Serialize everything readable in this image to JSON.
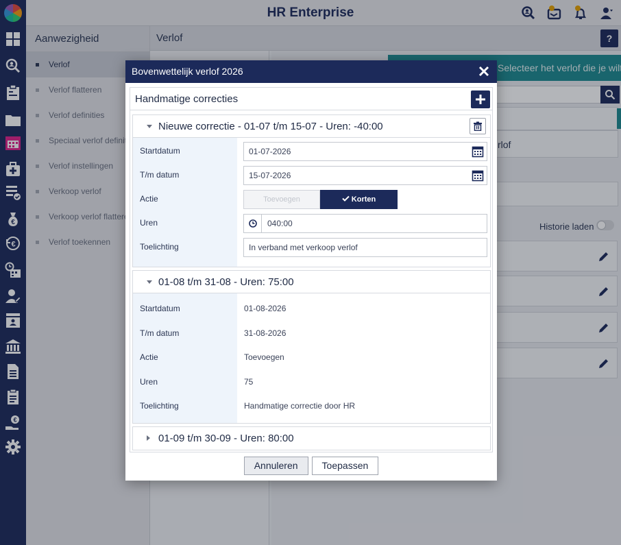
{
  "app": {
    "title": "HR Enterprise"
  },
  "sidebar": {
    "header": "Aanwezigheid",
    "items": [
      {
        "label": "Verlof"
      },
      {
        "label": "Verlof flatteren"
      },
      {
        "label": "Verlof definities"
      },
      {
        "label": "Speciaal verlof definities"
      },
      {
        "label": "Verlof instellingen"
      },
      {
        "label": "Verkoop verlof"
      },
      {
        "label": "Verkoop verlof flatteren"
      },
      {
        "label": "Verlof toekennen"
      }
    ]
  },
  "main": {
    "title": "Verlof",
    "help_label": "?",
    "banner_text": "Selecteer het verlof die je wilt aanvragen.",
    "list_item_text": "rlof",
    "history_label": "Historie laden"
  },
  "modal": {
    "title": "Bovenwettelijk verlof 2026",
    "section_title": "Handmatige correcties",
    "corrections": [
      {
        "title": "Nieuwe correctie - 01-07 t/m 15-07 - Uren: -40:00",
        "startdatum_label": "Startdatum",
        "startdatum": "01-07-2026",
        "tm_label": "T/m datum",
        "tm_datum": "15-07-2026",
        "actie_label": "Actie",
        "actie_options": [
          "Toevoegen",
          "Korten"
        ],
        "actie_selected": "Korten",
        "uren_label": "Uren",
        "uren": "040:00",
        "toelichting_label": "Toelichting",
        "toelichting": "In verband met verkoop verlof"
      },
      {
        "title": "01-08 t/m 31-08 - Uren: 75:00",
        "startdatum_label": "Startdatum",
        "startdatum": "01-08-2026",
        "tm_label": "T/m datum",
        "tm_datum": "31-08-2026",
        "actie_label": "Actie",
        "actie": "Toevoegen",
        "uren_label": "Uren",
        "uren": "75",
        "toelichting_label": "Toelichting",
        "toelichting": "Handmatige correctie door HR"
      },
      {
        "title": "01-09 t/m 30-09 - Uren: 80:00"
      }
    ],
    "cancel_label": "Annuleren",
    "apply_label": "Toepassen"
  },
  "colors": {
    "navy": "#1c2a5a",
    "teal": "#1d8a8f",
    "label_bg": "#eef4fb"
  }
}
